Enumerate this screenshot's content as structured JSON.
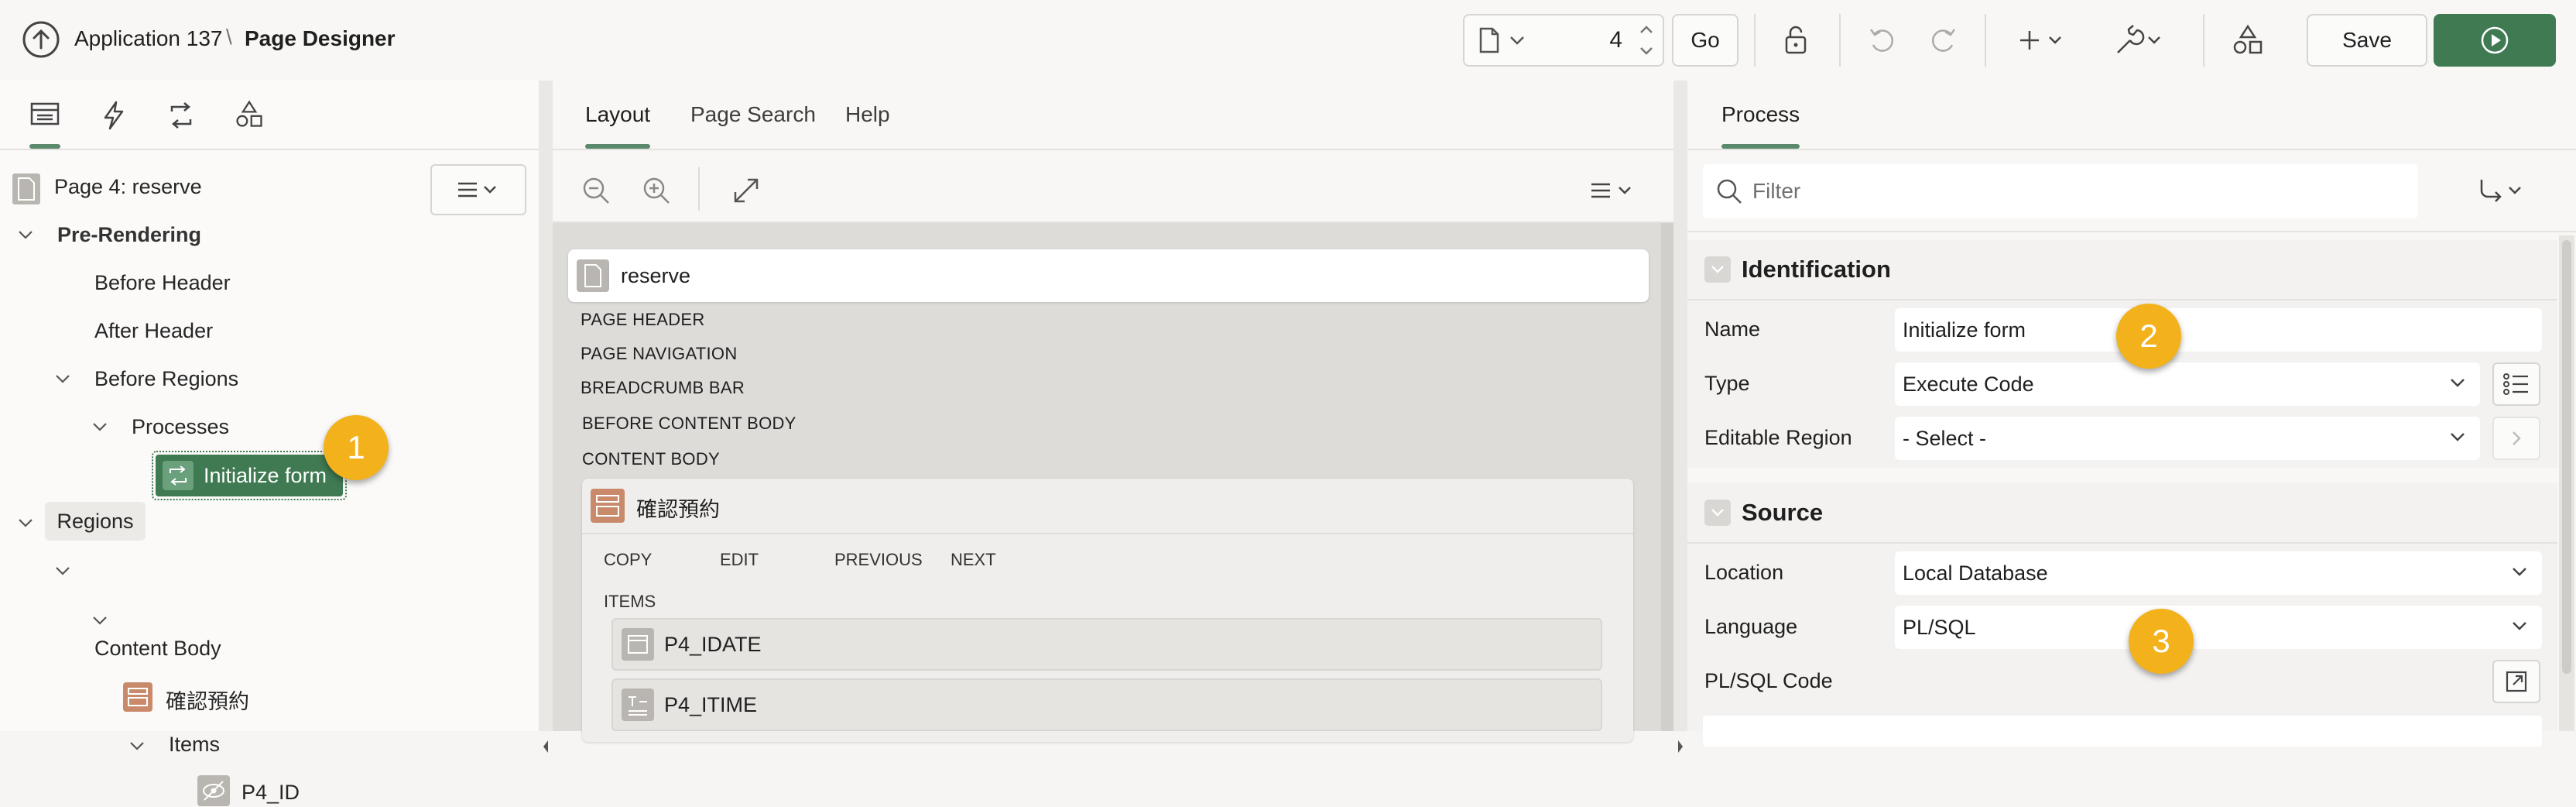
{
  "header": {
    "app_name": "Application 137",
    "separator": "\\",
    "page_title": "Page Designer",
    "page_number": "4",
    "go_label": "Go",
    "save_label": "Save"
  },
  "left": {
    "page_label": "Page 4: reserve",
    "tree": {
      "pre_rendering": "Pre-Rendering",
      "before_header": "Before Header",
      "after_header": "After Header",
      "before_regions": "Before Regions",
      "processes": "Processes",
      "initialize_form": "Initialize form",
      "regions": "Regions",
      "content_body": "Content Body",
      "region_name": "確認預約",
      "items": "Items",
      "p4_id": "P4_ID"
    }
  },
  "center": {
    "tabs": [
      "Layout",
      "Page Search",
      "Help"
    ],
    "page_name": "reserve",
    "positions": [
      "PAGE HEADER",
      "PAGE NAVIGATION",
      "BREADCRUMB BAR",
      "BEFORE CONTENT BODY",
      "CONTENT BODY"
    ],
    "region_title": "確認預約",
    "button_positions": [
      "COPY",
      "EDIT",
      "PREVIOUS",
      "NEXT"
    ],
    "items_label": "ITEMS",
    "items": [
      "P4_IDATE",
      "P4_ITIME"
    ]
  },
  "right": {
    "tab": "Process",
    "filter_placeholder": "Filter",
    "identification": {
      "title": "Identification",
      "name_label": "Name",
      "name_value": "Initialize form",
      "type_label": "Type",
      "type_value": "Execute Code",
      "editable_label": "Editable Region",
      "editable_value": "- Select -"
    },
    "source": {
      "title": "Source",
      "location_label": "Location",
      "location_value": "Local Database",
      "language_label": "Language",
      "language_value": "PL/SQL",
      "code_label": "PL/SQL Code"
    }
  },
  "callouts": [
    "1",
    "2",
    "3"
  ],
  "colors": {
    "accent_green": "#3f7a52",
    "callout_yellow": "#f3b21b",
    "tab_underline": "#5a8a6b"
  }
}
